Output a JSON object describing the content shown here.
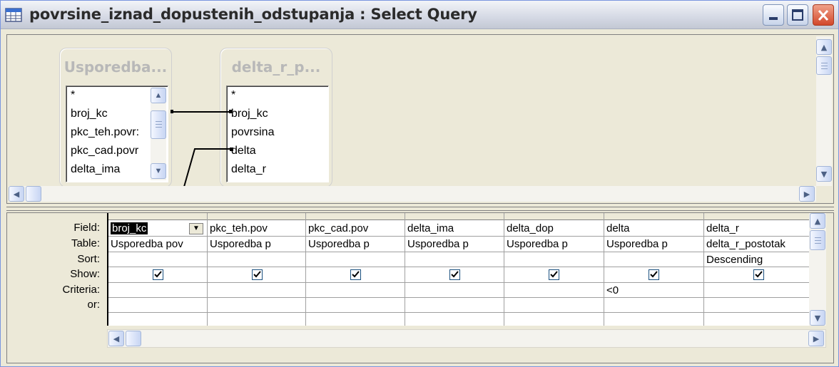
{
  "window": {
    "title": "povrsine_iznad_dopustenih_odstupanja : Select Query",
    "icon": "query-datasheet-icon"
  },
  "titlebar_buttons": {
    "minimize": "minimize-icon",
    "maximize": "maximize-icon",
    "close": "close-icon"
  },
  "tables": [
    {
      "title": "Usporedba...",
      "fields": [
        "*",
        "broj_kc",
        "pkc_teh.povr:",
        "pkc_cad.povr",
        "delta_ima"
      ]
    },
    {
      "title": "delta_r_p...",
      "fields": [
        "*",
        "broj_kc",
        "povrsina",
        "delta",
        "delta_r"
      ]
    }
  ],
  "grid": {
    "row_labels": [
      "Field:",
      "Table:",
      "Sort:",
      "Show:",
      "Criteria:",
      "or:"
    ],
    "columns": [
      {
        "field": "broj_kc",
        "table": "Usporedba pov",
        "sort": "",
        "show": true,
        "criteria": "",
        "or": ""
      },
      {
        "field": "pkc_teh.pov",
        "table": "Usporedba p",
        "sort": "",
        "show": true,
        "criteria": "",
        "or": ""
      },
      {
        "field": "pkc_cad.pov",
        "table": "Usporedba p",
        "sort": "",
        "show": true,
        "criteria": "",
        "or": ""
      },
      {
        "field": "delta_ima",
        "table": "Usporedba p",
        "sort": "",
        "show": true,
        "criteria": "",
        "or": ""
      },
      {
        "field": "delta_dop",
        "table": "Usporedba p",
        "sort": "",
        "show": true,
        "criteria": "",
        "or": ""
      },
      {
        "field": "delta",
        "table": "Usporedba p",
        "sort": "",
        "show": true,
        "criteria": "<0",
        "or": ""
      },
      {
        "field": "delta_r",
        "table": "delta_r_postotak",
        "sort": "Descending",
        "show": true,
        "criteria": "",
        "or": ""
      }
    ]
  }
}
